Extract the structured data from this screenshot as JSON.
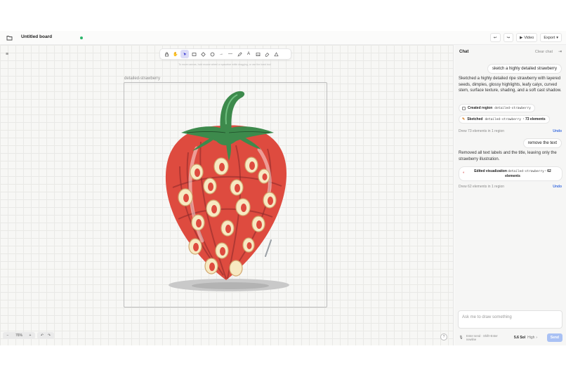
{
  "header": {
    "board_title": "Untitled board",
    "undo_icon": "undo-icon",
    "redo_icon": "redo-icon",
    "video_label": "Video",
    "export_label": "Export"
  },
  "toolbar": {
    "tools": [
      "lock-icon",
      "hand-icon",
      "select-icon",
      "rectangle-icon",
      "diamond-icon",
      "ellipse-icon",
      "arrow-icon",
      "line-icon",
      "pen-icon",
      "text-icon",
      "image-icon",
      "eraser-icon",
      "more-tools-icon"
    ],
    "hint": "To move canvas, hold mouse wheel or spacebar while dragging, or use the hand tool"
  },
  "canvas": {
    "frame_label": "detailed-strawberry",
    "zoom_minus": "−",
    "zoom_level": "76%",
    "zoom_plus": "+",
    "undo": "↶",
    "redo": "↷",
    "help": "?"
  },
  "chat": {
    "title": "Chat",
    "clear_label": "Clear chat",
    "messages": {
      "user_1": "sketch a highly detailed strawberry",
      "assistant_1": "Sketched a highly detailed ripe strawberry with layered seeds, dimples, glossy highlights, leafy calyx, curved stem, surface texture, shading, and a soft cast shadow.",
      "pill_region_label": "Created region",
      "pill_region_code": "detailed-strawberry",
      "pill_sketch_label": "Sketched",
      "pill_sketch_code": "detailed-strawberry",
      "pill_sketch_count": "· 73 elements",
      "drew_1": "Drew 73 elements in 1 region",
      "undo_1": "Undo",
      "user_2": "remove the text",
      "assistant_2": "Removed all text labels and the title, leaving only the strawberry illustration.",
      "pill_edit_label": "Edited visualization",
      "pill_edit_code": "detailed-strawberry",
      "pill_edit_count": "· 62 elements",
      "drew_2": "Drew 62 elements in 1 region",
      "undo_2": "Undo"
    },
    "input_placeholder": "Ask me to draw something",
    "footer_hint": "Enter send · Shift+Enter newline",
    "model": "5.6 Sol",
    "level": "High",
    "send_label": "Send"
  },
  "colors": {
    "berry": "#de4b3f",
    "leaf": "#3d8a4c",
    "seed": "#f7e9c2",
    "accent": "#3f6fe0"
  }
}
